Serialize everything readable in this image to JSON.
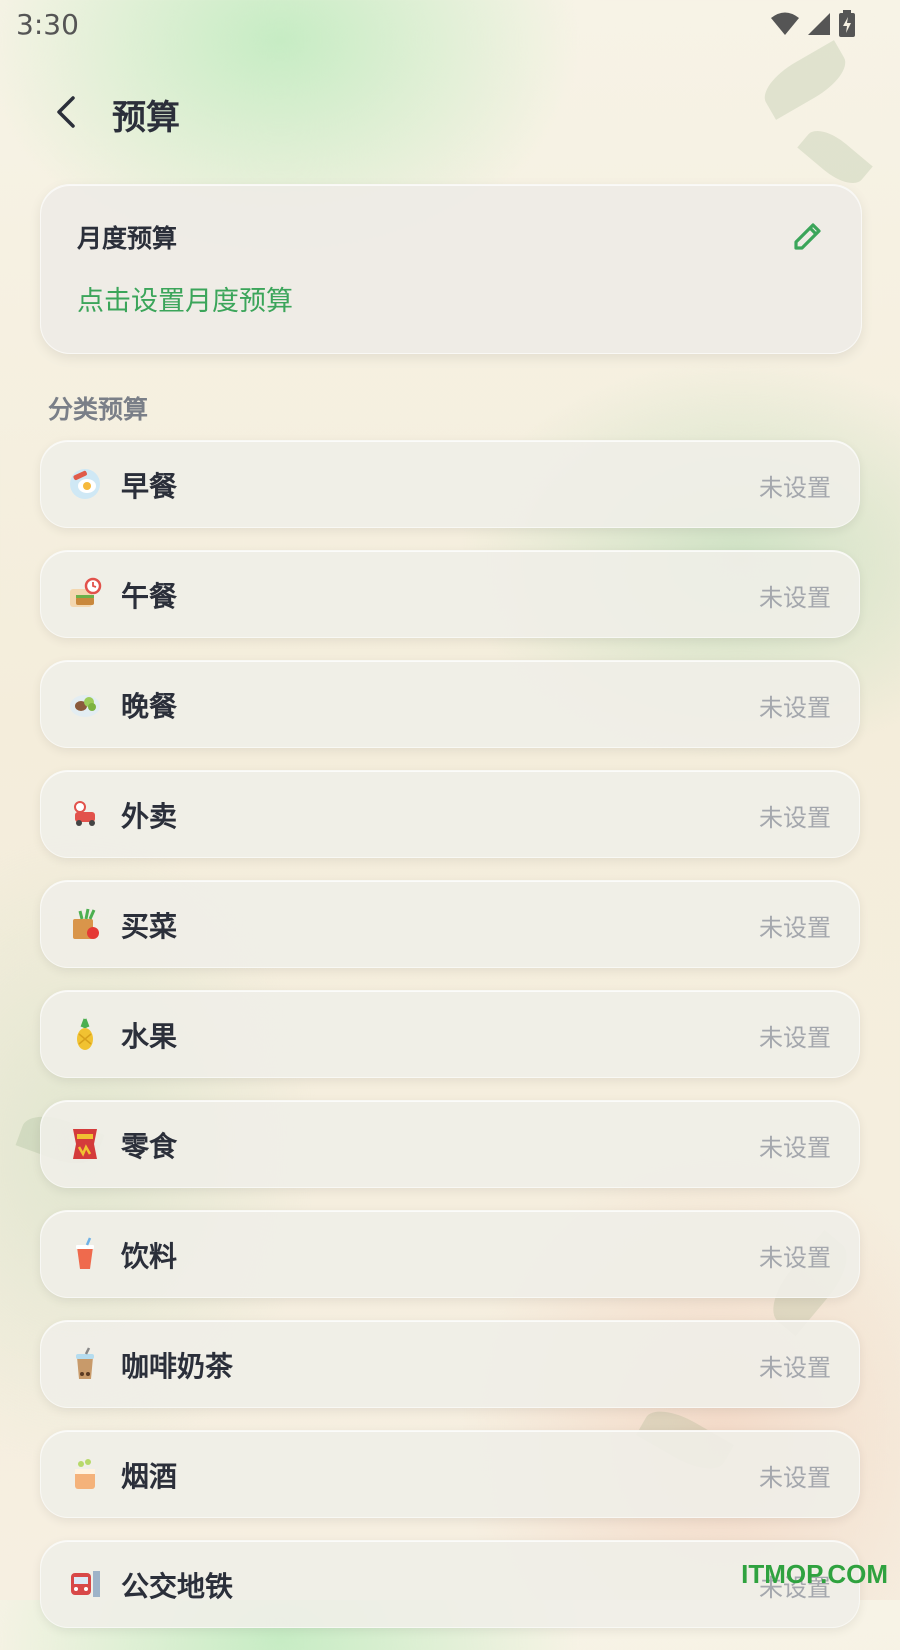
{
  "status_bar": {
    "time": "3:30"
  },
  "header": {
    "title": "预算"
  },
  "monthly": {
    "title": "月度预算",
    "hint": "点击设置月度预算"
  },
  "section_label": "分类预算",
  "categories": [
    {
      "name": "早餐",
      "status": "未设置",
      "icon": "breakfast-icon",
      "color": "#f2a35c"
    },
    {
      "name": "午餐",
      "status": "未设置",
      "icon": "lunch-icon",
      "color": "#e57c4f"
    },
    {
      "name": "晚餐",
      "status": "未设置",
      "icon": "dinner-icon",
      "color": "#8bbf5a"
    },
    {
      "name": "外卖",
      "status": "未设置",
      "icon": "delivery-icon",
      "color": "#e2524b"
    },
    {
      "name": "买菜",
      "status": "未设置",
      "icon": "groceries-icon",
      "color": "#d9954a"
    },
    {
      "name": "水果",
      "status": "未设置",
      "icon": "pineapple-icon",
      "color": "#f1c232"
    },
    {
      "name": "零食",
      "status": "未设置",
      "icon": "snack-icon",
      "color": "#d43b3b"
    },
    {
      "name": "饮料",
      "status": "未设置",
      "icon": "drink-icon",
      "color": "#ef6a4d"
    },
    {
      "name": "咖啡奶茶",
      "status": "未设置",
      "icon": "milk-tea-icon",
      "color": "#c89a6a"
    },
    {
      "name": "烟酒",
      "status": "未设置",
      "icon": "alcohol-icon",
      "color": "#f4b27a"
    },
    {
      "name": "公交地铁",
      "status": "未设置",
      "icon": "metro-icon",
      "color": "#d84848"
    }
  ],
  "watermark": "ITMOP.COM",
  "colors": {
    "accent": "#3ba55a",
    "muted": "#a4a7ad"
  }
}
